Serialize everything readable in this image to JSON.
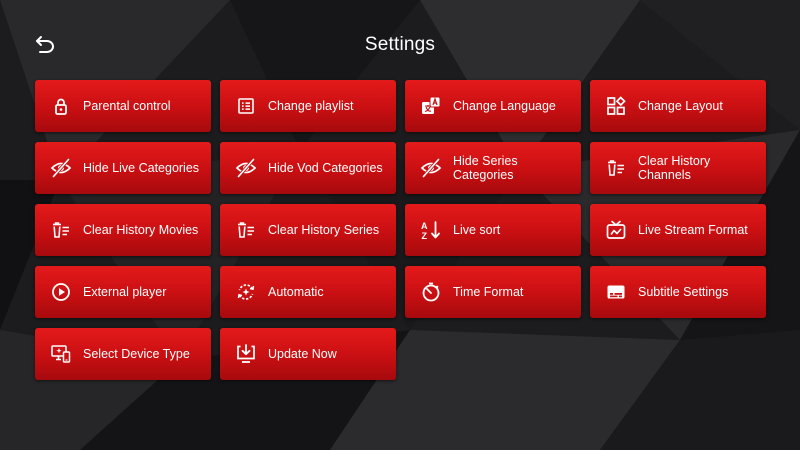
{
  "header": {
    "title": "Settings",
    "back_icon": "back-arrow-icon"
  },
  "colors": {
    "tile_top": "#e41a1a",
    "tile_bottom": "#a60a0d",
    "background": "#1d1d1f",
    "text": "#ffffff"
  },
  "tiles": [
    {
      "id": "parental-control",
      "label": "Parental control",
      "icon": "lock-icon"
    },
    {
      "id": "change-playlist",
      "label": "Change playlist",
      "icon": "list-icon"
    },
    {
      "id": "change-language",
      "label": "Change Language",
      "icon": "translate-icon"
    },
    {
      "id": "change-layout",
      "label": "Change Layout",
      "icon": "layout-icon"
    },
    {
      "id": "hide-live-categories",
      "label": "Hide Live Categories",
      "icon": "eye-off-icon"
    },
    {
      "id": "hide-vod-categories",
      "label": "Hide Vod Categories",
      "icon": "eye-off-icon"
    },
    {
      "id": "hide-series-categories",
      "label": "Hide Series\nCategories",
      "icon": "eye-off-icon"
    },
    {
      "id": "clear-history-channels",
      "label": "Clear History\nChannels",
      "icon": "clear-history-icon"
    },
    {
      "id": "clear-history-movies",
      "label": "Clear History Movies",
      "icon": "clear-history-icon"
    },
    {
      "id": "clear-history-series",
      "label": "Clear History Series",
      "icon": "clear-history-icon"
    },
    {
      "id": "live-sort",
      "label": "Live sort",
      "icon": "sort-alpha-icon"
    },
    {
      "id": "live-stream-format",
      "label": "Live Stream Format",
      "icon": "tv-icon"
    },
    {
      "id": "external-player",
      "label": "External player",
      "icon": "play-circle-icon"
    },
    {
      "id": "automatic",
      "label": "Automatic",
      "icon": "auto-refresh-icon"
    },
    {
      "id": "time-format",
      "label": "Time Format",
      "icon": "timer-icon"
    },
    {
      "id": "subtitle-settings",
      "label": "Subtitle Settings",
      "icon": "subtitles-icon"
    },
    {
      "id": "select-device-type",
      "label": "Select Device Type",
      "icon": "devices-icon"
    },
    {
      "id": "update-now",
      "label": "Update Now",
      "icon": "download-update-icon"
    }
  ]
}
